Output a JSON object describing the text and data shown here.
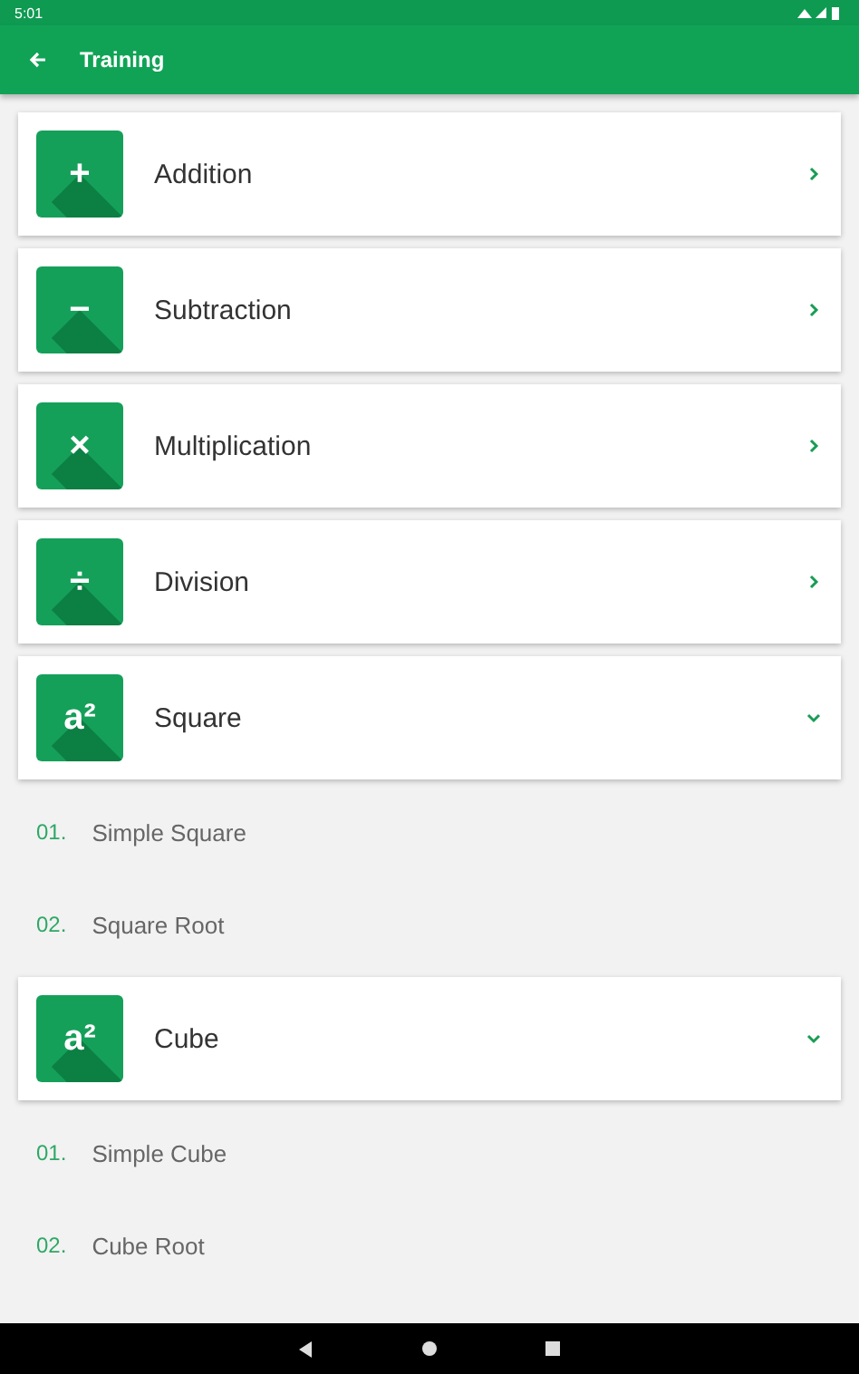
{
  "status_bar": {
    "time": "5:01"
  },
  "toolbar": {
    "title": "Training"
  },
  "topics": [
    {
      "kind": "link",
      "symbol": "+",
      "label": "Addition"
    },
    {
      "kind": "link",
      "symbol": "−",
      "label": "Subtraction"
    },
    {
      "kind": "link",
      "symbol": "×",
      "label": "Multiplication"
    },
    {
      "kind": "link",
      "symbol": "÷",
      "label": "Division"
    },
    {
      "kind": "group",
      "symbol": "a²",
      "label": "Square",
      "expanded": true,
      "children": [
        {
          "number": "01.",
          "label": "Simple Square"
        },
        {
          "number": "02.",
          "label": "Square Root"
        }
      ]
    },
    {
      "kind": "group",
      "symbol": "a²",
      "label": "Cube",
      "expanded": true,
      "children": [
        {
          "number": "01.",
          "label": "Simple Cube"
        },
        {
          "number": "02.",
          "label": "Cube Root"
        }
      ]
    }
  ]
}
